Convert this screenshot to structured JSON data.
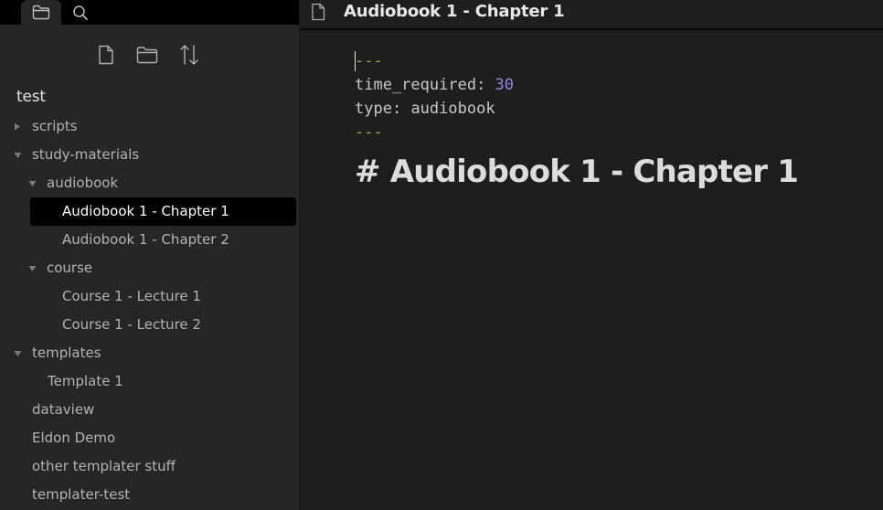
{
  "sidebar": {
    "tabs": [
      {
        "name": "files",
        "icon": "folder-icon",
        "active": true
      },
      {
        "name": "search",
        "icon": "search-icon",
        "active": false
      }
    ],
    "actions": [
      {
        "icon": "new-note-icon"
      },
      {
        "icon": "new-folder-icon"
      },
      {
        "icon": "sort-icon"
      }
    ],
    "vault_name": "test",
    "tree": [
      {
        "label": "scripts",
        "type": "folder",
        "collapsed": true
      },
      {
        "label": "study-materials",
        "type": "folder",
        "collapsed": false
      },
      {
        "label": "audiobook",
        "type": "folder",
        "collapsed": false
      },
      {
        "label": "Audiobook 1 - Chapter 1",
        "type": "file",
        "selected": true
      },
      {
        "label": "Audiobook 1 - Chapter 2",
        "type": "file"
      },
      {
        "label": "course",
        "type": "folder",
        "collapsed": false
      },
      {
        "label": "Course 1 - Lecture 1",
        "type": "file"
      },
      {
        "label": "Course 1 - Lecture 2",
        "type": "file"
      },
      {
        "label": "templates",
        "type": "folder",
        "collapsed": false
      },
      {
        "label": "Template 1",
        "type": "file"
      },
      {
        "label": "dataview",
        "type": "file"
      },
      {
        "label": "Eldon Demo",
        "type": "file"
      },
      {
        "label": "other templater stuff",
        "type": "file"
      },
      {
        "label": "templater-test",
        "type": "file"
      }
    ]
  },
  "editor": {
    "tab_title": "Audiobook 1 - Chapter 1",
    "frontmatter": {
      "open": "---",
      "close": "---",
      "fields": [
        {
          "key": "time_required",
          "sep": ": ",
          "value": "30"
        },
        {
          "key": "type",
          "sep": ": ",
          "value": "audiobook"
        }
      ]
    },
    "heading": "# Audiobook 1 - Chapter 1"
  },
  "colors": {
    "background": "#1e1e1e",
    "sidebar": "#262626",
    "frontmatter_delimiter": "#a8a33a",
    "number_value": "#9b82e8"
  }
}
